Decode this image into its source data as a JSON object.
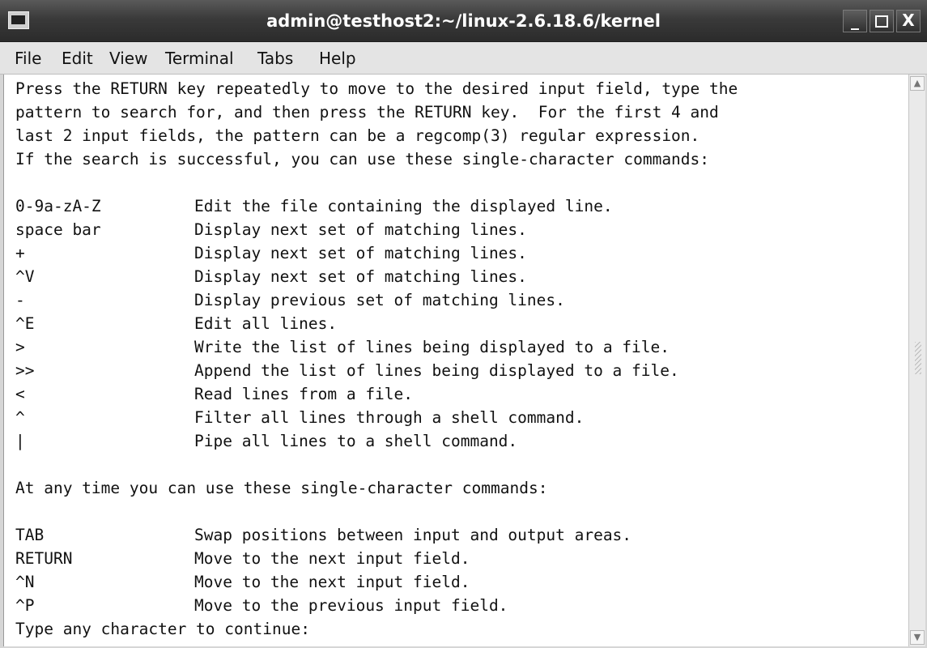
{
  "window": {
    "title": "admin@testhost2:~/linux-2.6.18.6/kernel",
    "minimize_label": "_",
    "close_label": "X"
  },
  "menu": {
    "items": [
      "File",
      "Edit",
      "View",
      "Terminal",
      "Tabs",
      "Help"
    ]
  },
  "terminal": {
    "intro": [
      "Press the RETURN key repeatedly to move to the desired input field, type the",
      "pattern to search for, and then press the RETURN key.  For the first 4 and",
      "last 2 input fields, the pattern can be a regcomp(3) regular expression.",
      "If the search is successful, you can use these single-character commands:"
    ],
    "commands": [
      {
        "key": "0-9a-zA-Z",
        "desc": "Edit the file containing the displayed line."
      },
      {
        "key": "space bar",
        "desc": "Display next set of matching lines."
      },
      {
        "key": "+",
        "desc": "Display next set of matching lines."
      },
      {
        "key": "^V",
        "desc": "Display next set of matching lines."
      },
      {
        "key": "-",
        "desc": "Display previous set of matching lines."
      },
      {
        "key": "^E",
        "desc": "Edit all lines."
      },
      {
        "key": ">",
        "desc": "Write the list of lines being displayed to a file."
      },
      {
        "key": ">>",
        "desc": "Append the list of lines being displayed to a file."
      },
      {
        "key": "<",
        "desc": "Read lines from a file."
      },
      {
        "key": "^",
        "desc": "Filter all lines through a shell command."
      },
      {
        "key": "|",
        "desc": "Pipe all lines to a shell command."
      }
    ],
    "anytime_heading": "At any time you can use these single-character commands:",
    "anytime_commands": [
      {
        "key": "TAB",
        "desc": "Swap positions between input and output areas."
      },
      {
        "key": "RETURN",
        "desc": "Move to the next input field."
      },
      {
        "key": "^N",
        "desc": "Move to the next input field."
      },
      {
        "key": "^P",
        "desc": "Move to the previous input field."
      }
    ],
    "prompt": "Type any character to continue:"
  },
  "icons": {
    "window_icon": "terminal-icon",
    "scroll_up": "scroll-up-arrow-icon",
    "scroll_down": "scroll-down-arrow-icon"
  }
}
